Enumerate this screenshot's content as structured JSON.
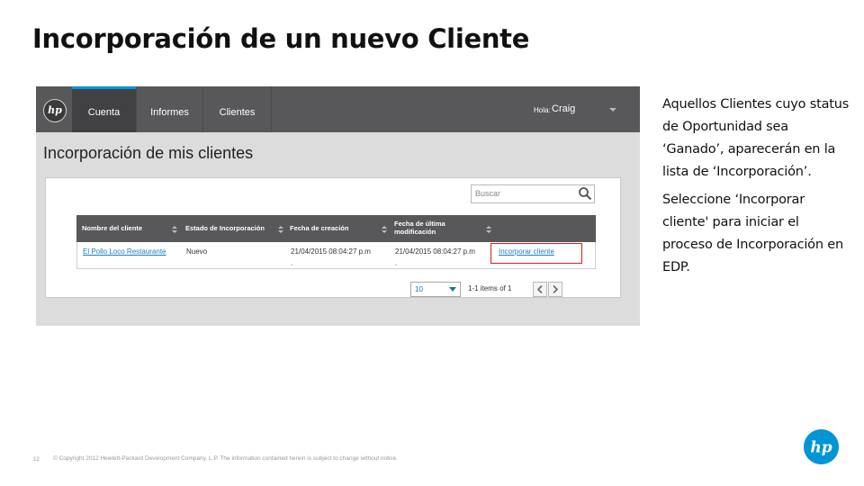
{
  "slide": {
    "title": "Incorporación de un nuevo Cliente",
    "description": [
      "Aquellos Clientes cuyo status de Oportunidad sea ‘Ganado’, aparecerán en la lista de ‘Incorporación’.",
      "Seleccione ‘Incorporar cliente' para iniciar el proceso de Incorporación en EDP."
    ],
    "page_number": "12",
    "copyright": "© Copyright 2012 Hewlett-Packard Development Company, L.P. The information contained herein is subject to change without notice.",
    "logo_icon": "hp-logo",
    "logo_text": "hp",
    "accent_color": "#0096d6"
  },
  "app": {
    "logo_text": "hp",
    "nav": {
      "tabs": [
        {
          "label": "Cuenta",
          "active": true
        },
        {
          "label": "Informes",
          "active": false
        },
        {
          "label": "Clientes",
          "active": false
        }
      ],
      "greeting": "Hola:",
      "user_name": "Craig",
      "user_menu_icon": "caret-down-icon"
    },
    "page_title": "Incorporación de mis clientes",
    "search": {
      "placeholder": "Buscar",
      "icon": "search-icon"
    },
    "table": {
      "columns": [
        "Nombre del cliente",
        "Estado de Incorporación",
        "Fecha de creación",
        "Fecha de última modificación",
        ""
      ],
      "rows": [
        {
          "client": "El Pollo Loco Restaurante",
          "status": "Nuevo",
          "created": "21/04/2015 08:04:27 p.m",
          "created_extra": ".",
          "modified": "21/04/2015 08:04:27 p.m",
          "modified_extra": ".",
          "action": "Incorporar cliente"
        }
      ],
      "highlight_color": "#d02020"
    },
    "pagination": {
      "page_size": "10",
      "info": "1-1 items of 1"
    }
  }
}
